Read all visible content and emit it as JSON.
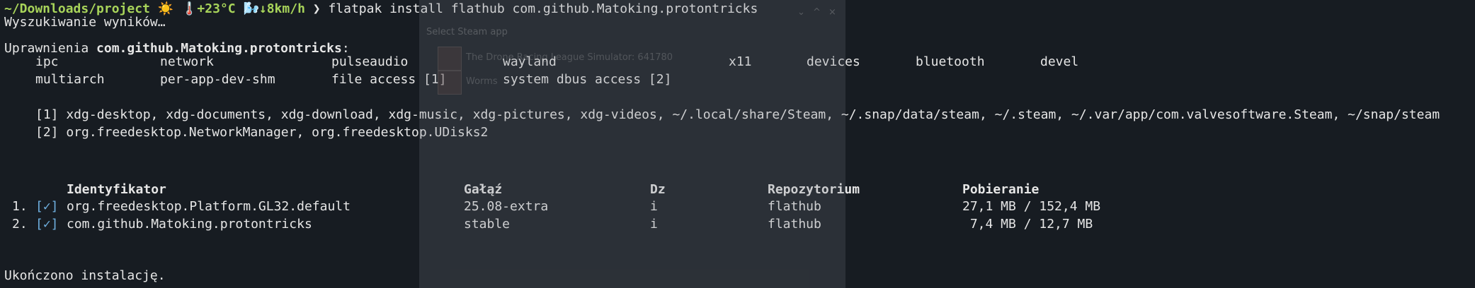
{
  "prompt": {
    "path": "~/Downloads/project",
    "weather_icon": "☀️",
    "temp": "🌡️+23°C",
    "wind": "🌬️↓8km/h",
    "arrow": "❯",
    "command": "flatpak install flathub com.github.Matoking.protontricks"
  },
  "output": {
    "searching": "Wyszukiwanie wyników…",
    "permissions_label": "Uprawnienia ",
    "permissions_app": "com.github.Matoking.protontricks",
    "permissions_colon": ":",
    "perm_row1": [
      "ipc",
      "network",
      "pulseaudio",
      "wayland",
      "x11",
      "devices",
      "bluetooth",
      "devel"
    ],
    "perm_row2": [
      "multiarch",
      "per-app-dev-shm",
      "file access [1]",
      "system dbus access [2]"
    ],
    "footnote1": "[1] xdg-desktop, xdg-documents, xdg-download, xdg-music, xdg-pictures, xdg-videos, ~/.local/share/Steam, ~/.snap/data/steam, ~/.steam, ~/.var/app/com.valvesoftware.Steam, ~/snap/steam",
    "footnote2": "[2] org.freedesktop.NetworkManager, org.freedesktop.UDisks2",
    "table": {
      "headers": [
        "Identyfikator",
        "Gałąź",
        "Dz",
        "Repozytorium",
        "Pobieranie"
      ],
      "rows": [
        {
          "num": "1.",
          "check": "[✓]",
          "id": "org.freedesktop.Platform.GL32.default",
          "branch": "25.08-extra",
          "op": "i",
          "repo": "flathub",
          "download": "27,1 MB / 152,4 MB"
        },
        {
          "num": "2.",
          "check": "[✓]",
          "id": "com.github.Matoking.protontricks",
          "branch": "stable",
          "op": "i",
          "repo": "flathub",
          "download": " 7,4 MB / 12,7 MB"
        }
      ]
    },
    "done": "Ukończono instalację."
  },
  "ghost_window": {
    "title": "Select Steam app",
    "controls": [
      "⌄",
      "^",
      "×"
    ],
    "items": [
      "The Drone Racing League Simulator: 641780",
      "Worms"
    ]
  }
}
